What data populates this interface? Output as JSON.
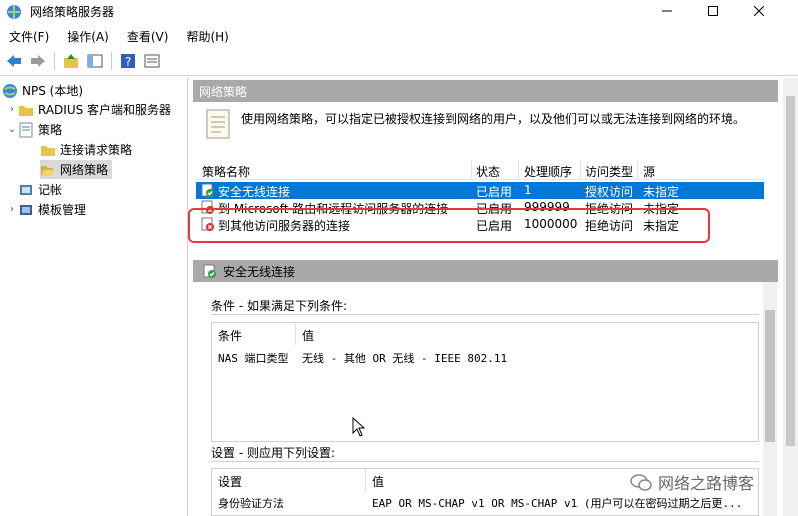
{
  "window": {
    "title": "网络策略服务器"
  },
  "menu": [
    "文件(F)",
    "操作(A)",
    "查看(V)",
    "帮助(H)"
  ],
  "tree": {
    "root": "NPS (本地)",
    "radius": "RADIUS 客户端和服务器",
    "policies": "策略",
    "connection_request": "连接请求策略",
    "network_policies": "网络策略",
    "accounting": "记帐",
    "templates": "模板管理"
  },
  "main": {
    "header": "网络策略",
    "description": "使用网络策略，可以指定已被授权连接到网络的用户，以及他们可以或无法连接到网络的环境。",
    "columns": [
      "策略名称",
      "状态",
      "处理顺序",
      "访问类型",
      "源"
    ],
    "rows": [
      {
        "name": "安全无线连接",
        "status": "已启用",
        "order": "1",
        "access": "授权访问",
        "source": "未指定"
      },
      {
        "name": "到 Microsoft 路由和远程访问服务器的连接",
        "status": "已启用",
        "order": "999999",
        "access": "拒绝访问",
        "source": "未指定"
      },
      {
        "name": "到其他访问服务器的连接",
        "status": "已启用",
        "order": "1000000",
        "access": "拒绝访问",
        "source": "未指定"
      }
    ]
  },
  "details": {
    "title": "安全无线连接",
    "conditions_label": "条件 - 如果满足下列条件:",
    "conditions_cols": [
      "条件",
      "值"
    ],
    "condition_name": "NAS 端口类型",
    "condition_value": "无线 - 其他 OR 无线 - IEEE 802.11",
    "settings_label": "设置 - 则应用下列设置:",
    "settings_cols": [
      "设置",
      "值"
    ],
    "setting_name": "身份验证方法",
    "setting_value": "EAP OR MS-CHAP v1 OR MS-CHAP v1 (用户可以在密码过期之后更..."
  },
  "watermark": "网络之路博客",
  "colors": {
    "selection": "#0078d7",
    "highlight_box": "#e53935",
    "header_bg": "#a9a9a9"
  }
}
